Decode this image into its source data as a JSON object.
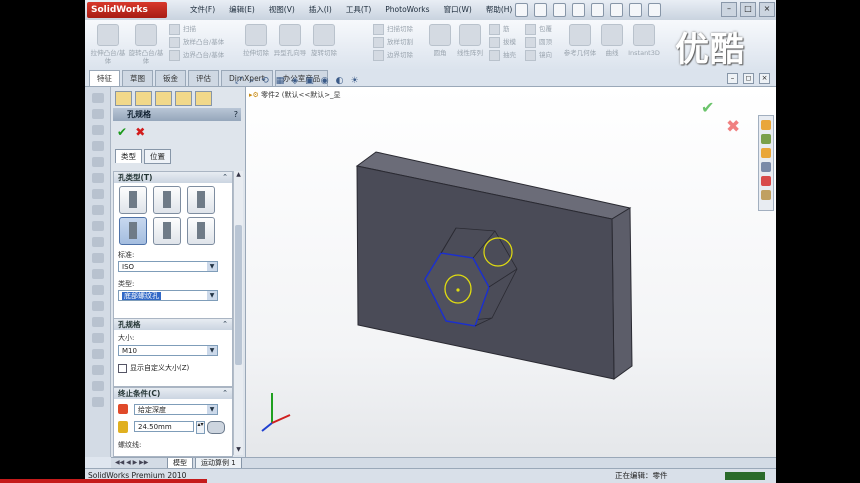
{
  "window": {
    "app_name": "SolidWorks",
    "menu": [
      "文件(F)",
      "编辑(E)",
      "视图(V)",
      "插入(I)",
      "工具(T)",
      "PhotoWorks",
      "窗口(W)",
      "帮助(H)"
    ],
    "win_buttons": [
      "–",
      "□",
      "×"
    ]
  },
  "ribbon": {
    "large_buttons": [
      {
        "label": "拉伸凸台/基体"
      },
      {
        "label": "旋转凸台/基体"
      },
      {
        "label": "拉伸切除"
      },
      {
        "label": "异型孔向导"
      },
      {
        "label": "旋转切除"
      },
      {
        "label": "圆角"
      },
      {
        "label": "线性阵列"
      },
      {
        "label": "参考几何体"
      },
      {
        "label": "曲线"
      },
      {
        "label": "Instant3D"
      }
    ],
    "small_buttons": [
      {
        "label": "扫描"
      },
      {
        "label": "放样凸台/基体"
      },
      {
        "label": "边界凸台/基体"
      },
      {
        "label": "扫描切除"
      },
      {
        "label": "放样切割"
      },
      {
        "label": "边界切除"
      },
      {
        "label": "筋"
      },
      {
        "label": "拔模"
      },
      {
        "label": "抽壳"
      },
      {
        "label": "包覆"
      },
      {
        "label": "圆顶"
      },
      {
        "label": "镜向"
      }
    ]
  },
  "tabs": [
    "特征",
    "草图",
    "钣金",
    "评估",
    "DimXpert",
    "办公室产品"
  ],
  "tab_icons": [
    "–",
    "◻",
    "×"
  ],
  "property_manager": {
    "title": "孔规格",
    "help": "?",
    "ok": "✔",
    "cancel": "✖",
    "subtabs": [
      "类型",
      "位置"
    ],
    "hole_type_header": "孔类型(T)",
    "standard_label": "标准:",
    "standard_value": "ISO",
    "type_label": "类型:",
    "type_value": "底部螺纹孔",
    "spec_header": "孔规格",
    "size_label": "大小:",
    "size_value": "M10",
    "custom_size_checkbox": "显示自定义大小(Z)",
    "end_condition_header": "终止条件(C)",
    "end_condition_value": "给定深度",
    "depth_value": "24.50mm",
    "thread_label": "螺纹线:"
  },
  "viewport": {
    "breadcrumb_part": "零件2",
    "breadcrumb_config": "(默认<<默认>_显",
    "colors": {
      "plate_front": "#4a4b57",
      "plate_side": "#5c5d69",
      "plate_top": "#6b6c78",
      "hex_edge": "#1a2fd0",
      "circle": "#e0dc10"
    }
  },
  "bottom_tabs": [
    "模型",
    "运动算例 1"
  ],
  "status": {
    "left": "SolidWorks Premium 2010",
    "right": "正在编辑：零件"
  },
  "watermark": "优酷"
}
